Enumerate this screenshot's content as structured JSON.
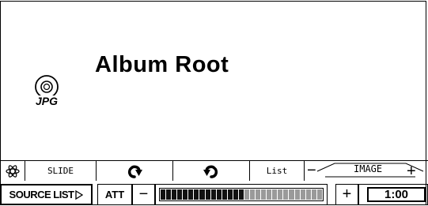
{
  "main": {
    "title": "Album Root",
    "icon": "jpg-disc-icon",
    "icon_text": "JPG"
  },
  "toolbar1": {
    "slide_label": "SLIDE",
    "list_label": "List",
    "image_label": "IMAGE",
    "image_minus": "−",
    "image_plus": "+"
  },
  "toolbar2": {
    "source_label": "SOURCE LIST",
    "att_label": "ATT",
    "minus_label": "−",
    "plus_label": "+",
    "clock": "1:00",
    "level": {
      "active_segments": 15,
      "total_segments": 29
    }
  }
}
